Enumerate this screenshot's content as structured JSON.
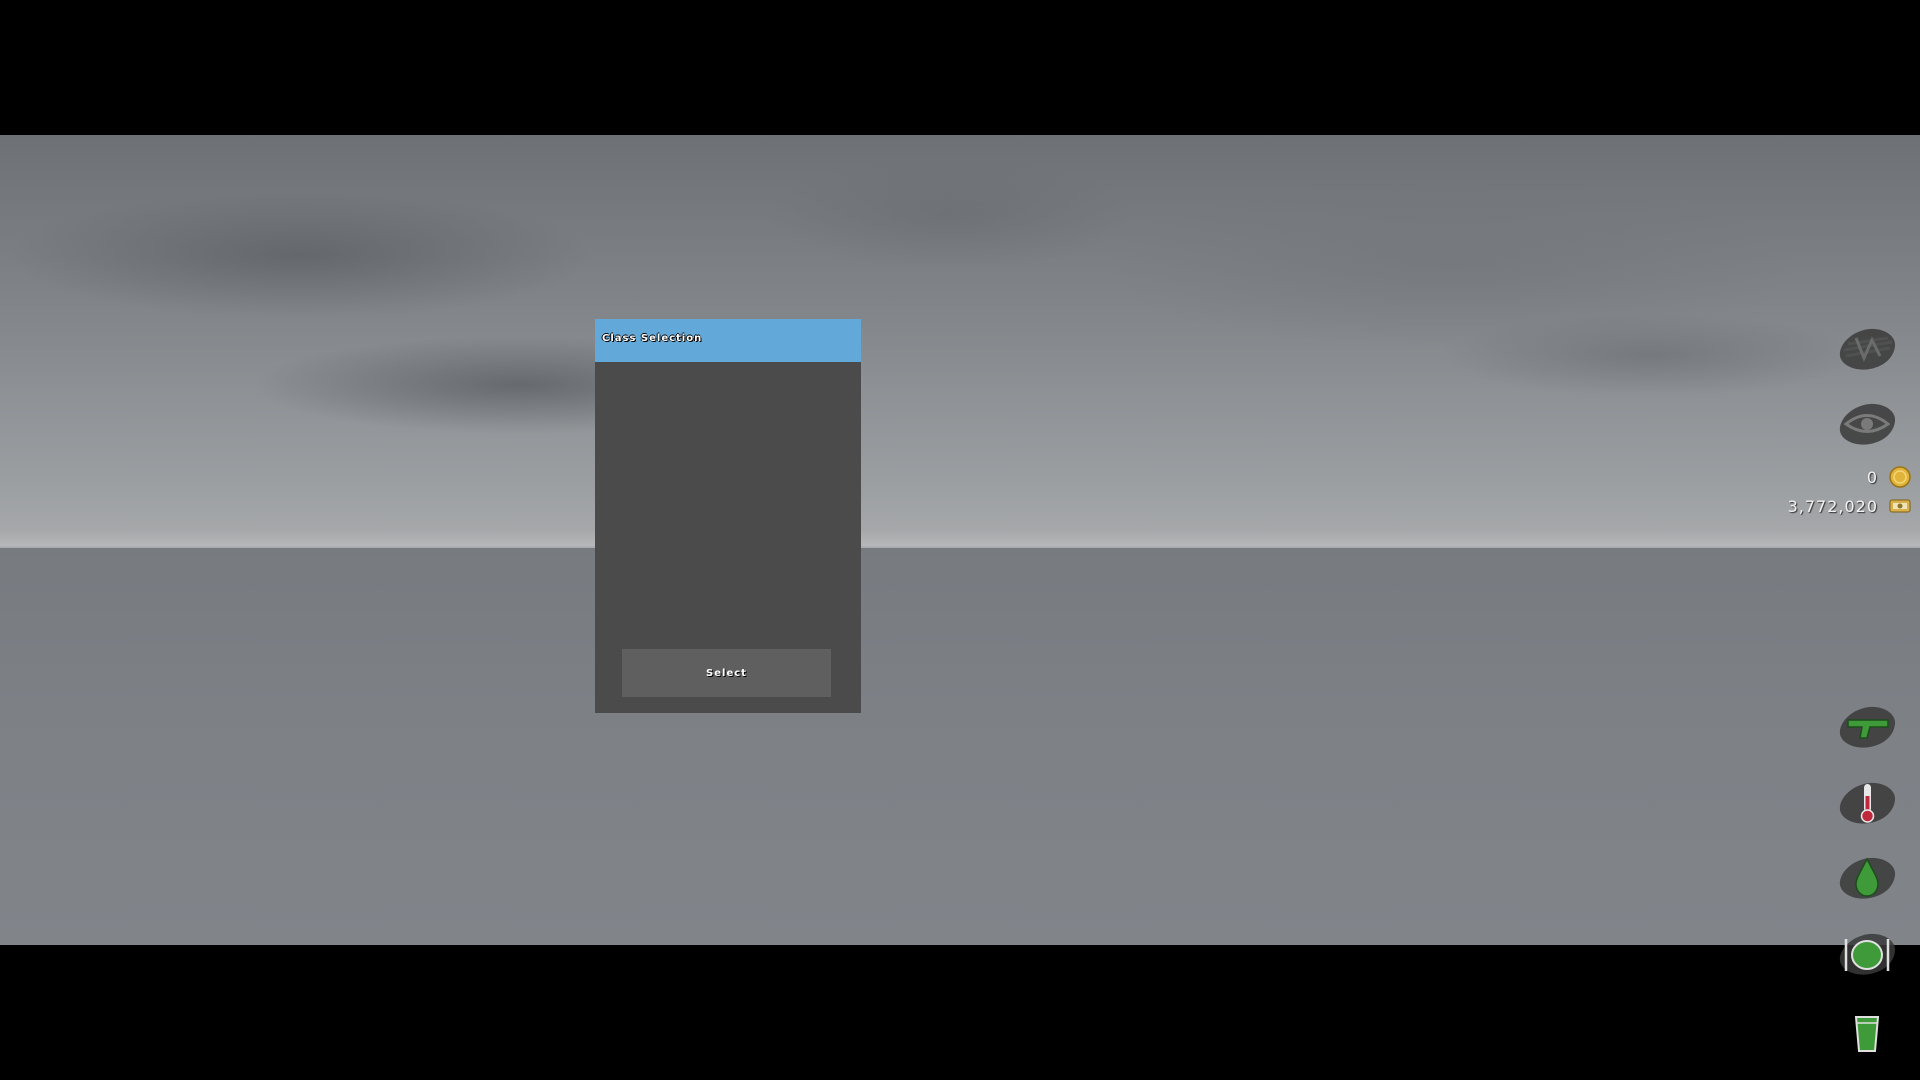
{
  "dialog": {
    "title": "Class Selection",
    "select_label": "Select",
    "header_color": "#62a8d8",
    "body_color": "#4b4b4b"
  },
  "hud": {
    "top_icons": [
      "map-icon",
      "eye-icon"
    ],
    "currency": [
      {
        "value": "0",
        "icon": "coin-icon"
      },
      {
        "value": "3,772,020",
        "icon": "cash-icon"
      }
    ],
    "status_icons": [
      "weapon-icon",
      "temperature-icon",
      "water-drop-icon",
      "food-icon",
      "drink-icon"
    ],
    "status_color": "#3f9a3a"
  }
}
